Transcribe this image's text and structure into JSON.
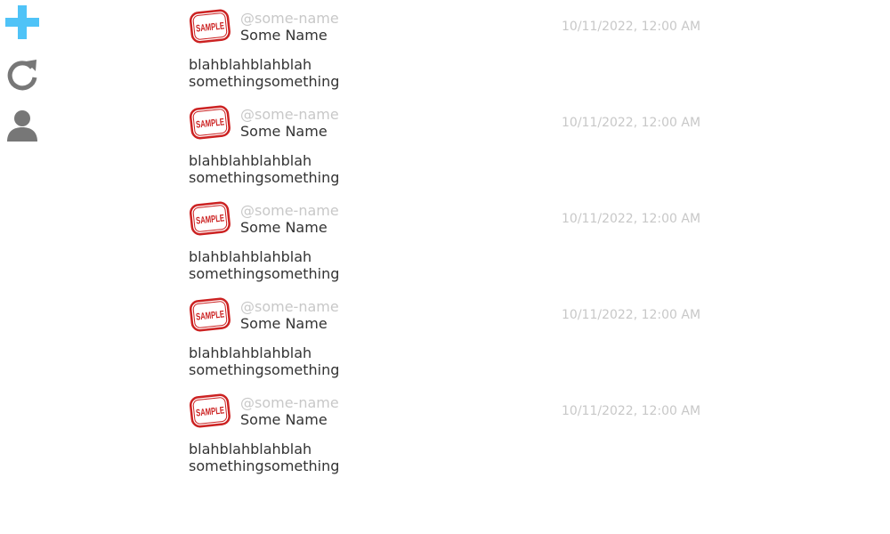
{
  "sidebar": {
    "items": [
      {
        "name": "add-icon",
        "color": "#4fc3f7"
      },
      {
        "name": "refresh-icon",
        "color": "#777777"
      },
      {
        "name": "profile-icon",
        "color": "#777777"
      }
    ]
  },
  "avatar": {
    "stamp_text": "SAMPLE",
    "stamp_color": "#cc2222"
  },
  "posts": [
    {
      "handle": "@some-name",
      "name": "Some Name",
      "timestamp": "10/11/2022, 12:00 AM",
      "line1": "blahblahblahblah",
      "line2": "somethingsomething"
    },
    {
      "handle": "@some-name",
      "name": "Some Name",
      "timestamp": "10/11/2022, 12:00 AM",
      "line1": "blahblahblahblah",
      "line2": "somethingsomething"
    },
    {
      "handle": "@some-name",
      "name": "Some Name",
      "timestamp": "10/11/2022, 12:00 AM",
      "line1": "blahblahblahblah",
      "line2": "somethingsomething"
    },
    {
      "handle": "@some-name",
      "name": "Some Name",
      "timestamp": "10/11/2022, 12:00 AM",
      "line1": "blahblahblahblah",
      "line2": "somethingsomething"
    },
    {
      "handle": "@some-name",
      "name": "Some Name",
      "timestamp": "10/11/2022, 12:00 AM",
      "line1": "blahblahblahblah",
      "line2": "somethingsomething"
    }
  ]
}
